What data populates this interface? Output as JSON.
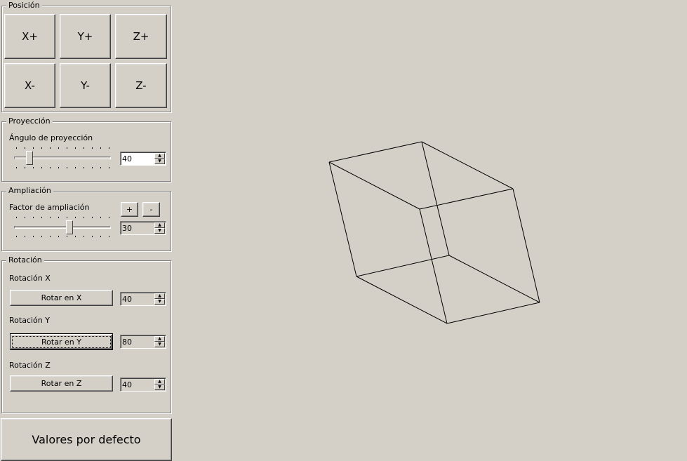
{
  "posicion": {
    "title": "Posición",
    "buttons": [
      "X+",
      "Y+",
      "Z+",
      "X-",
      "Y-",
      "Z-"
    ]
  },
  "proyeccion": {
    "title": "Proyección",
    "label": "Ángulo de proyección",
    "value": "40",
    "slider_level": 0.13
  },
  "ampliacion": {
    "title": "Ampliación",
    "label": "Factor de ampliación",
    "plus": "+",
    "minus": "-",
    "value": "30",
    "slider_level": 0.58
  },
  "rotacion": {
    "title": "Rotación",
    "x_label": "Rotación X",
    "x_button": "Rotar en X",
    "x_value": "40",
    "y_label": "Rotación Y",
    "y_button": "Rotar en Y",
    "y_value": "80",
    "z_label": "Rotación Z",
    "z_button": "Rotar en Z",
    "z_value": "40"
  },
  "reset_button": "Valores por defecto",
  "colors": {
    "background": "#d4d0c8",
    "line": "#000000"
  },
  "icons": {
    "spin_up": "up-arrow-icon",
    "spin_down": "down-arrow-icon"
  }
}
